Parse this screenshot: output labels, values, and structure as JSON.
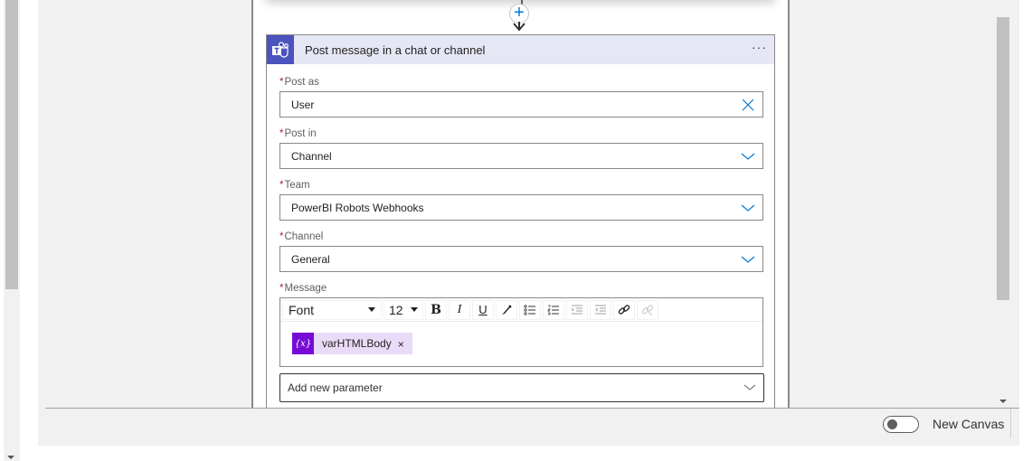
{
  "action_card": {
    "title": "Post message in a chat or channel",
    "icon": "teams-icon",
    "more_label": "···"
  },
  "connector": {
    "add_label": "+"
  },
  "fields": {
    "post_as": {
      "label": "Post as",
      "required": "*",
      "value": "User",
      "action_icon": "clear-icon"
    },
    "post_in": {
      "label": "Post in",
      "required": "*",
      "value": "Channel",
      "action_icon": "chevron-down-icon"
    },
    "team": {
      "label": "Team",
      "required": "*",
      "value": "PowerBI Robots Webhooks",
      "action_icon": "chevron-down-icon"
    },
    "channel": {
      "label": "Channel",
      "required": "*",
      "value": "General",
      "action_icon": "chevron-down-icon"
    },
    "message": {
      "label": "Message",
      "required": "*",
      "toolbar": {
        "font": "Font",
        "size": "12",
        "bold": "B",
        "italic": "I",
        "underline": "U"
      },
      "token": {
        "icon_label": "{x}",
        "label": "varHTMLBody",
        "remove": "×"
      }
    }
  },
  "add_parameter": {
    "placeholder": "Add new parameter"
  },
  "footer": {
    "toggle_label": "New Canvas",
    "toggle_state": "off"
  },
  "colors": {
    "teams_brand": "#4b53bc",
    "header_bg": "#e6e7f4",
    "token_icon": "#770bd6",
    "token_bg": "#e9dbf7",
    "accent": "#0078d4",
    "required": "#a4262c"
  }
}
